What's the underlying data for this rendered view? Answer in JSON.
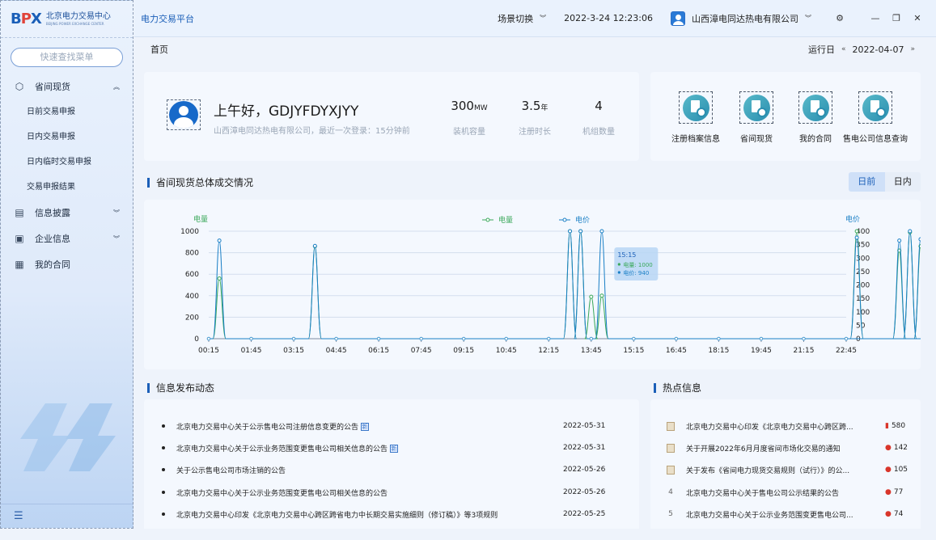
{
  "sidebar": {
    "logo_mark": "BPX",
    "logo_cn": "北京电力交易中心",
    "logo_en": "BEIJING POWER EXCHANGE CENTER",
    "search_placeholder": "快速查找菜单",
    "groups": [
      {
        "label": "省间现货",
        "icon": "cube-icon",
        "expanded": true,
        "items": [
          "日前交易申报",
          "日内交易申报",
          "日内临时交易申报",
          "交易申报结果"
        ]
      },
      {
        "label": "信息披露",
        "icon": "document-icon",
        "expanded": false,
        "items": []
      },
      {
        "label": "企业信息",
        "icon": "monitor-icon",
        "expanded": false,
        "items": []
      },
      {
        "label": "我的合同",
        "icon": "contract-icon",
        "expanded": false,
        "items": []
      }
    ]
  },
  "topbar": {
    "platform": "电力交易平台",
    "scene_switch": "场景切换",
    "datetime": "2022-3-24 12:23:06",
    "company": "山西漳电同达热电有限公司"
  },
  "breadcrumb": {
    "home": "首页"
  },
  "run_day": {
    "label": "运行日",
    "date": "2022-04-07"
  },
  "welcome": {
    "greeting": "上午好，GDJYFDYXJYY",
    "sub": "山西漳电同达热电有限公司，最近一次登录：15分钟前",
    "stats": [
      {
        "value": "300",
        "unit": "MW",
        "label": "装机容量"
      },
      {
        "value": "3.5",
        "unit": "年",
        "label": "注册时长"
      },
      {
        "value": "4",
        "unit": "",
        "label": "机组数量"
      }
    ]
  },
  "shortcuts": [
    {
      "label": "注册档案信息",
      "icon": "register-file-icon"
    },
    {
      "label": "省间现货",
      "icon": "spot-trade-icon"
    },
    {
      "label": "我的合同",
      "icon": "contract-doc-icon"
    },
    {
      "label": "售电公司信息查询",
      "icon": "company-search-icon"
    }
  ],
  "trade_section": {
    "title": "省间现货总体成交情况",
    "tabs": [
      "日前",
      "日内"
    ],
    "active_tab": "日前"
  },
  "chart_data": {
    "type": "line",
    "left_axis_label": "电量",
    "right_axis_label": "电价",
    "legend": [
      "电量",
      "电价"
    ],
    "x_ticks": [
      "00:15",
      "01:45",
      "03:15",
      "04:45",
      "06:15",
      "07:45",
      "09:15",
      "10:45",
      "12:15",
      "13:45",
      "15:15",
      "16:45",
      "18:15",
      "19:45",
      "21:15",
      "22:45"
    ],
    "ylim_left": [
      0,
      1000
    ],
    "yticks_left": [
      0,
      200,
      400,
      600,
      800,
      1000
    ],
    "ylim_right": [
      0,
      400
    ],
    "yticks_right": [
      0,
      50,
      100,
      150,
      200,
      250,
      300,
      350,
      400
    ],
    "grid": true,
    "series": [
      {
        "name": "电量",
        "color": "#3aa85a",
        "points": [
          [
            0.25,
            560
          ],
          [
            2.5,
            860
          ],
          [
            8.5,
            1000
          ],
          [
            8.75,
            1000
          ],
          [
            9.0,
            390
          ],
          [
            9.25,
            400
          ],
          [
            15.25,
            1000
          ],
          [
            16.25,
            820
          ],
          [
            16.5,
            990
          ],
          [
            16.75,
            860
          ],
          [
            22.75,
            790
          ]
        ]
      },
      {
        "name": "电价",
        "color": "#1a7fc6",
        "points": [
          [
            0.25,
            365
          ],
          [
            2.5,
            345
          ],
          [
            8.5,
            400
          ],
          [
            8.75,
            400
          ],
          [
            9.25,
            400
          ],
          [
            15.25,
            376
          ],
          [
            16.25,
            365
          ],
          [
            16.5,
            400
          ],
          [
            16.75,
            370
          ],
          [
            17.0,
            360
          ],
          [
            22.75,
            400
          ]
        ]
      }
    ],
    "tooltip": {
      "time": "15:15",
      "rows": [
        {
          "name": "电量",
          "value": "1000"
        },
        {
          "name": "电价",
          "value": "940"
        }
      ]
    }
  },
  "news": {
    "title": "信息发布动态",
    "items": [
      {
        "text": "北京电力交易中心关于公示售电公司注册信息变更的公告",
        "new": "新",
        "date": "2022-05-31"
      },
      {
        "text": "北京电力交易中心关于公示业务范围变更售电公司相关信息的公告",
        "new": "新",
        "date": "2022-05-31"
      },
      {
        "text": "关于公示售电公司市场注销的公告",
        "new": "",
        "date": "2022-05-26"
      },
      {
        "text": "北京电力交易中心关于公示业务范围变更售电公司相关信息的公告",
        "new": "",
        "date": "2022-05-26"
      },
      {
        "text": "北京电力交易中心印发《北京电力交易中心跨区跨省电力中长期交易实施细则（修订稿）》等3项规则",
        "new": "",
        "date": "2022-05-25"
      }
    ]
  },
  "hot": {
    "title": "热点信息",
    "items": [
      {
        "rank": "",
        "text": "北京电力交易中心印发《北京电力交易中心跨区跨...",
        "count": "580"
      },
      {
        "rank": "",
        "text": "关于开展2022年6月月度省间市场化交易的通知",
        "count": "142"
      },
      {
        "rank": "",
        "text": "关于发布《省间电力现货交易规则（试行）》的公...",
        "count": "105"
      },
      {
        "rank": "4",
        "text": "北京电力交易中心关于售电公司公示结果的公告",
        "count": "77"
      },
      {
        "rank": "5",
        "text": "北京电力交易中心关于公示业务范围变更售电公司...",
        "count": "74"
      }
    ]
  }
}
